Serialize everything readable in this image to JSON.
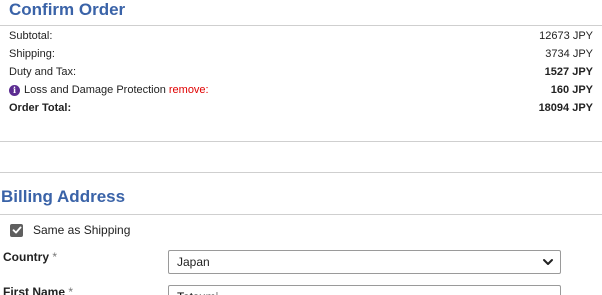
{
  "confirm_order": {
    "title": "Confirm Order",
    "rows": [
      {
        "label": "Subtotal:",
        "value": "12673 JPY"
      },
      {
        "label": "Shipping:",
        "value": "3734 JPY"
      },
      {
        "label": "Duty and Tax:",
        "value": "1527 JPY"
      },
      {
        "label": "Loss and Damage Protection",
        "remove": "remove:",
        "value": "160 JPY"
      },
      {
        "label": "Order Total:",
        "value": "18094 JPY"
      }
    ]
  },
  "billing": {
    "title": "Billing Address",
    "same_as_shipping": "Same as Shipping",
    "country_label": "Country",
    "country_value": "Japan",
    "first_name_label": "First Name",
    "first_name_value": "Tatsumi",
    "required_mark": "*"
  },
  "icons": {
    "info": "info-icon",
    "checkbox_checked": "checkmark-icon",
    "select_arrow": "chevron-down-icon"
  }
}
